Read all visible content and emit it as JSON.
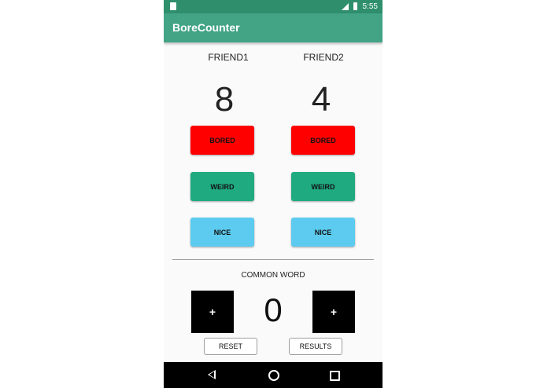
{
  "status_bar": {
    "time": "5:55"
  },
  "app": {
    "title": "BoreCounter"
  },
  "friend1": {
    "name": "FRIEND1",
    "score": "8",
    "bored_label": "BORED",
    "weird_label": "WEIRD",
    "nice_label": "NICE"
  },
  "friend2": {
    "name": "FRIEND2",
    "score": "4",
    "bored_label": "BORED",
    "weird_label": "WEIRD",
    "nice_label": "NICE"
  },
  "common": {
    "label": "COMMON WORD",
    "score": "0",
    "left_plus_label": "+",
    "right_plus_label": "+",
    "reset_label": "RESET",
    "results_label": "RESULTS"
  },
  "colors": {
    "statusbar": "#2f8f6c",
    "toolbar": "#42a385",
    "bored": "#ff0000",
    "weird": "#1faa80",
    "nice": "#5ccbef"
  }
}
